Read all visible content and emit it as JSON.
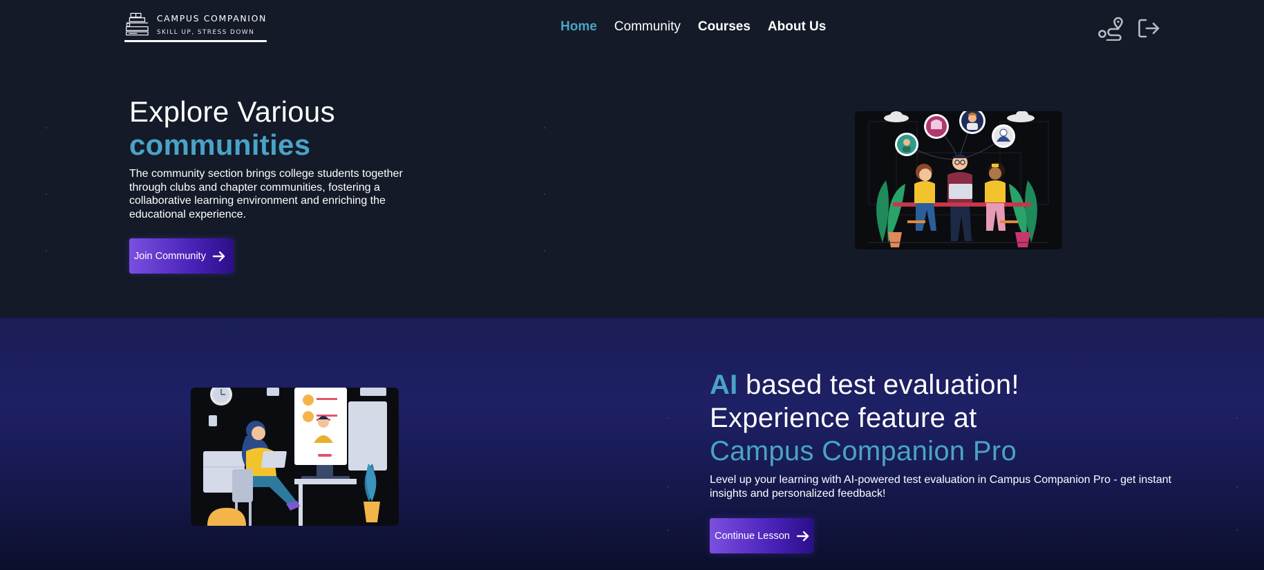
{
  "brand": {
    "title": "CAMPUS COMPANION",
    "tagline": "SKILL UP, STRESS DOWN"
  },
  "nav": {
    "items": [
      {
        "label": "Home",
        "active": true
      },
      {
        "label": "Community"
      },
      {
        "label": "Courses"
      },
      {
        "label": "About Us"
      }
    ]
  },
  "header_icons": {
    "route": "route-icon",
    "logout": "logout-icon"
  },
  "hero": {
    "title": "Explore Various",
    "title_accent": "communities",
    "description": "The community section brings college students together through clubs and chapter communities, fostering a collaborative learning environment and enriching the educational experience.",
    "button_label": "Join Community"
  },
  "pro": {
    "title_ai": "AI",
    "title_rest": "based test evaluation!",
    "title_line2": "Experience feature at",
    "title_line3": "Campus Companion Pro",
    "description": "Level up your learning with AI-powered test evaluation in Campus Companion Pro - get instant insights and personalized feedback!",
    "button_label": "Continue Lesson"
  },
  "colors": {
    "accent": "#4aa3c7",
    "background": "#141a28",
    "section2_bg": "#1e2066",
    "button_start": "#7b4fe0",
    "button_end": "#2b0f88"
  }
}
